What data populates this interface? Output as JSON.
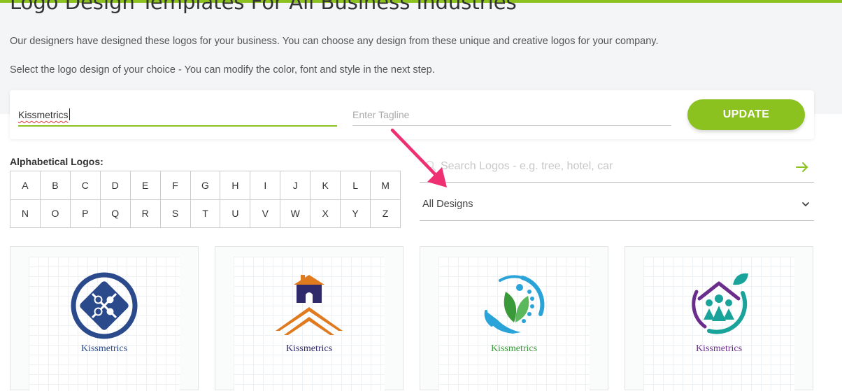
{
  "header": {
    "title": "Logo Design Templates For All Business Industries",
    "description_1": "Our designers have designed these logos for your business. You can choose any design from these unique and creative logos for your company.",
    "description_2": "Select the logo design of your choice - You can modify the color, font and style in the next step."
  },
  "form": {
    "business_name_value": "Kissmetrics",
    "tagline_placeholder": "Enter Tagline",
    "update_label": "UPDATE"
  },
  "alphabet": {
    "label": "Alphabetical Logos:",
    "letters": [
      "A",
      "B",
      "C",
      "D",
      "E",
      "F",
      "G",
      "H",
      "I",
      "J",
      "K",
      "L",
      "M",
      "N",
      "O",
      "P",
      "Q",
      "R",
      "S",
      "T",
      "U",
      "V",
      "W",
      "X",
      "Y",
      "Z"
    ]
  },
  "search": {
    "placeholder": "Search Logos - e.g. tree, hotel, car",
    "icon": "search-icon",
    "submit_icon": "arrow-right-icon"
  },
  "filter": {
    "selected": "All Designs",
    "icon": "chevron-down-icon"
  },
  "logos": [
    {
      "name": "Kissmetrics",
      "icon": "puzzle-emblem-icon",
      "color": "#2b4a8b"
    },
    {
      "name": "Kissmetrics",
      "icon": "house-roof-icon",
      "color": "#2e2a6b"
    },
    {
      "name": "Kissmetrics",
      "icon": "leaf-hand-icon",
      "color": "#3a9a3a"
    },
    {
      "name": "Kissmetrics",
      "icon": "family-house-icon",
      "color": "#6b2d8b"
    }
  ],
  "colors": {
    "accent": "#8cc21f",
    "annotation_arrow": "#ee2f72"
  }
}
